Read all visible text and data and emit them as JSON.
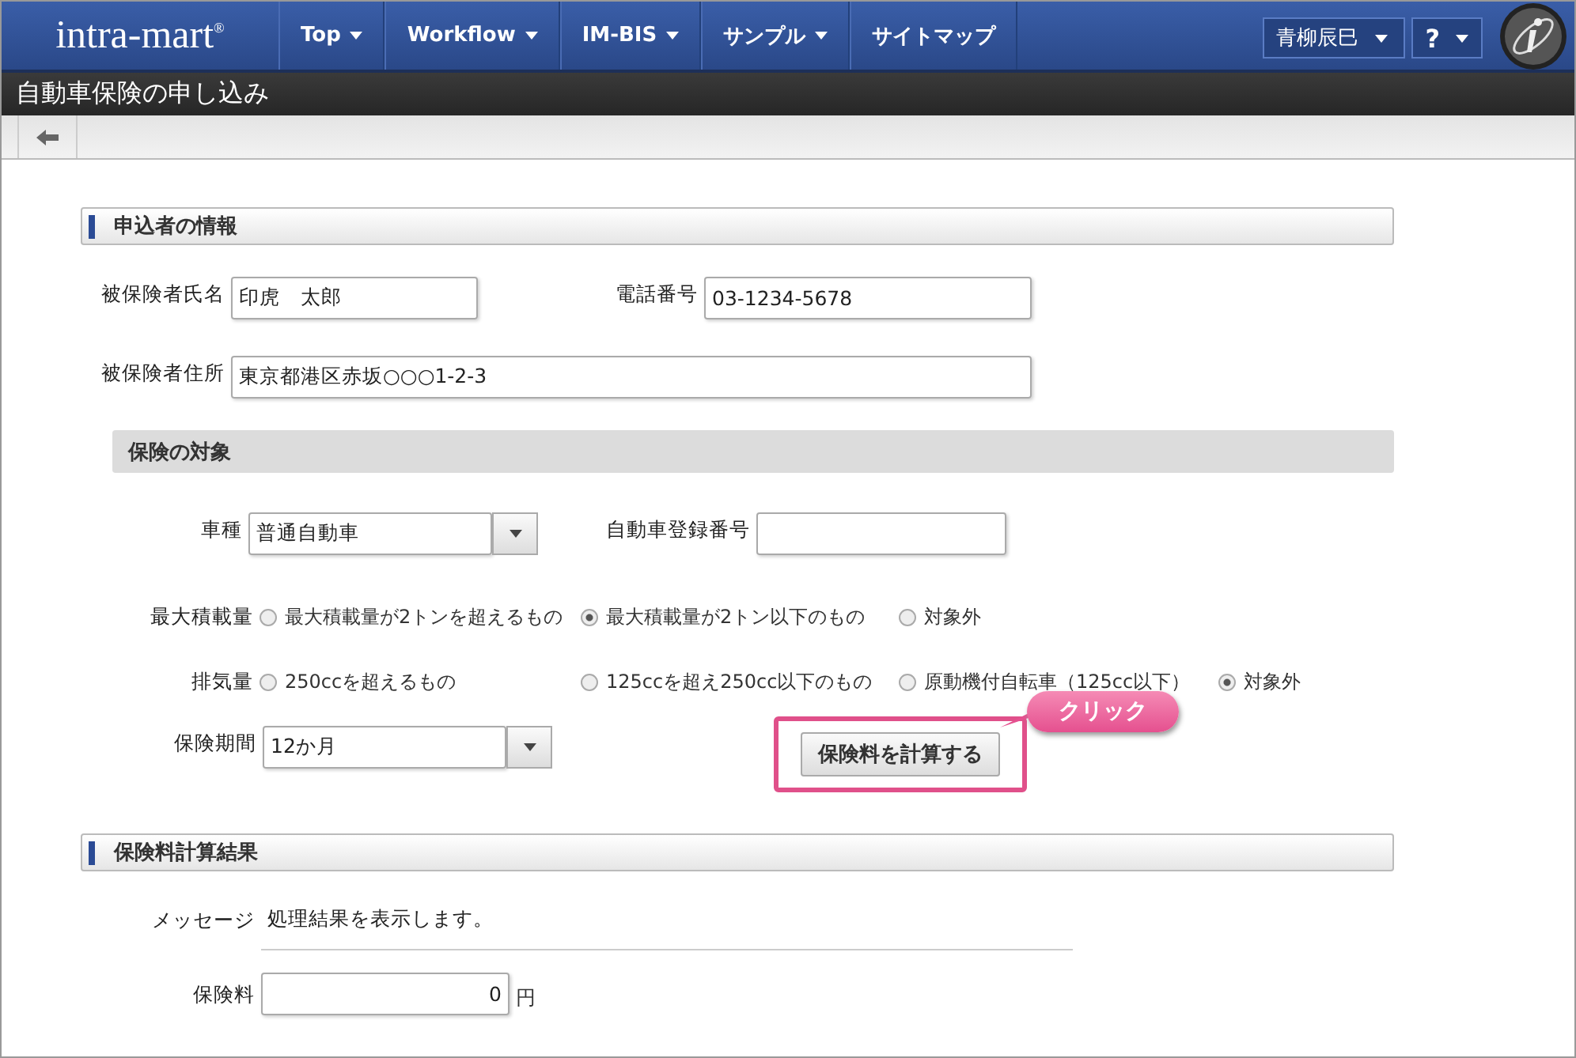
{
  "header": {
    "logo": "intra-mart",
    "logo_mark": "®",
    "menu": [
      {
        "label": "Top",
        "dropdown": true
      },
      {
        "label": "Workflow",
        "dropdown": true
      },
      {
        "label": "IM-BIS",
        "dropdown": true
      },
      {
        "label": "サンプル",
        "dropdown": true
      },
      {
        "label": "サイトマップ",
        "dropdown": false
      }
    ],
    "user": "青柳辰巳",
    "help": "?"
  },
  "page_title": "自動車保険の申し込み",
  "applicant": {
    "title": "申込者の情報",
    "name": {
      "label": "被保険者氏名",
      "value": "印虎　太郎"
    },
    "phone": {
      "label": "電話番号",
      "value": "03-1234-5678"
    },
    "address": {
      "label": "被保険者住所",
      "value": "東京都港区赤坂○○○1-2-3"
    }
  },
  "target": {
    "title": "保険の対象",
    "car_type": {
      "label": "車種",
      "value": "普通自動車"
    },
    "reg_no": {
      "label": "自動車登録番号"
    },
    "radio_groups": [
      {
        "label": "最大積載量",
        "options": [
          {
            "label": "最大積載量が2トンを超えるもの",
            "selected": false
          },
          {
            "label": "最大積載量が2トン以下のもの",
            "selected": true
          },
          {
            "label": "対象外",
            "selected": false
          }
        ]
      },
      {
        "label": "排気量",
        "options": [
          {
            "label": "250ccを超えるもの",
            "selected": false
          },
          {
            "label": "125ccを超え250cc以下のもの",
            "selected": false
          },
          {
            "label": "原動機付自転車（125cc以下）",
            "selected": false
          },
          {
            "label": "対象外",
            "selected": true
          }
        ]
      }
    ],
    "period": {
      "label": "保険期間",
      "value": "12か月"
    },
    "calc_button": "保険料を計算する",
    "callout": "クリック"
  },
  "result": {
    "title": "保険料計算結果",
    "message": {
      "label": "メッセージ",
      "value": "処理結果を表示します。"
    },
    "fee": {
      "label": "保険料",
      "value": "0",
      "unit": "円"
    }
  }
}
